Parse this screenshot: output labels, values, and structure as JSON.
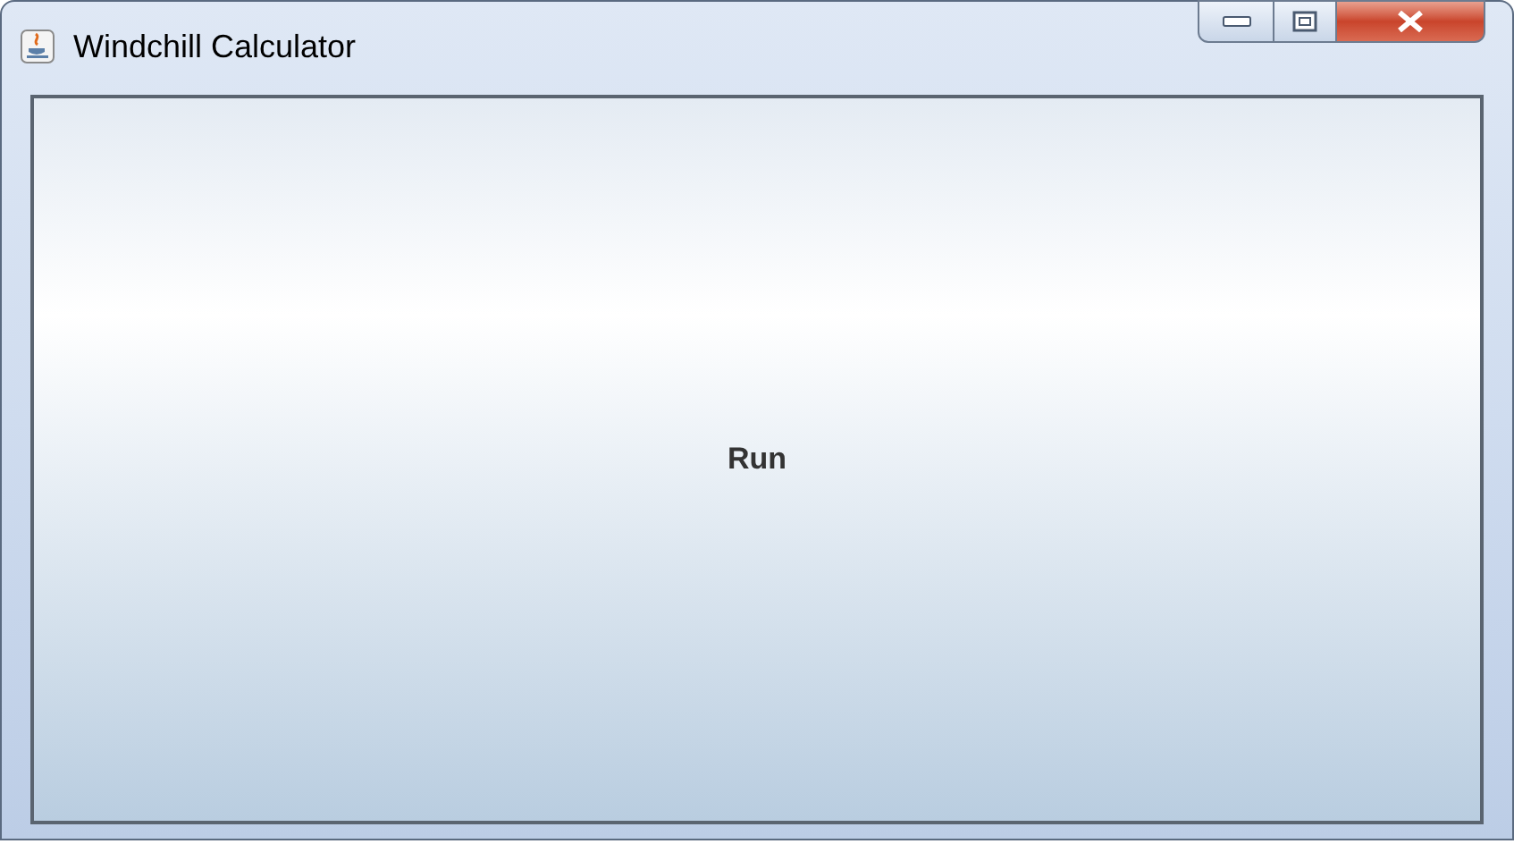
{
  "window": {
    "title": "Windchill Calculator"
  },
  "button": {
    "label": "Run"
  }
}
